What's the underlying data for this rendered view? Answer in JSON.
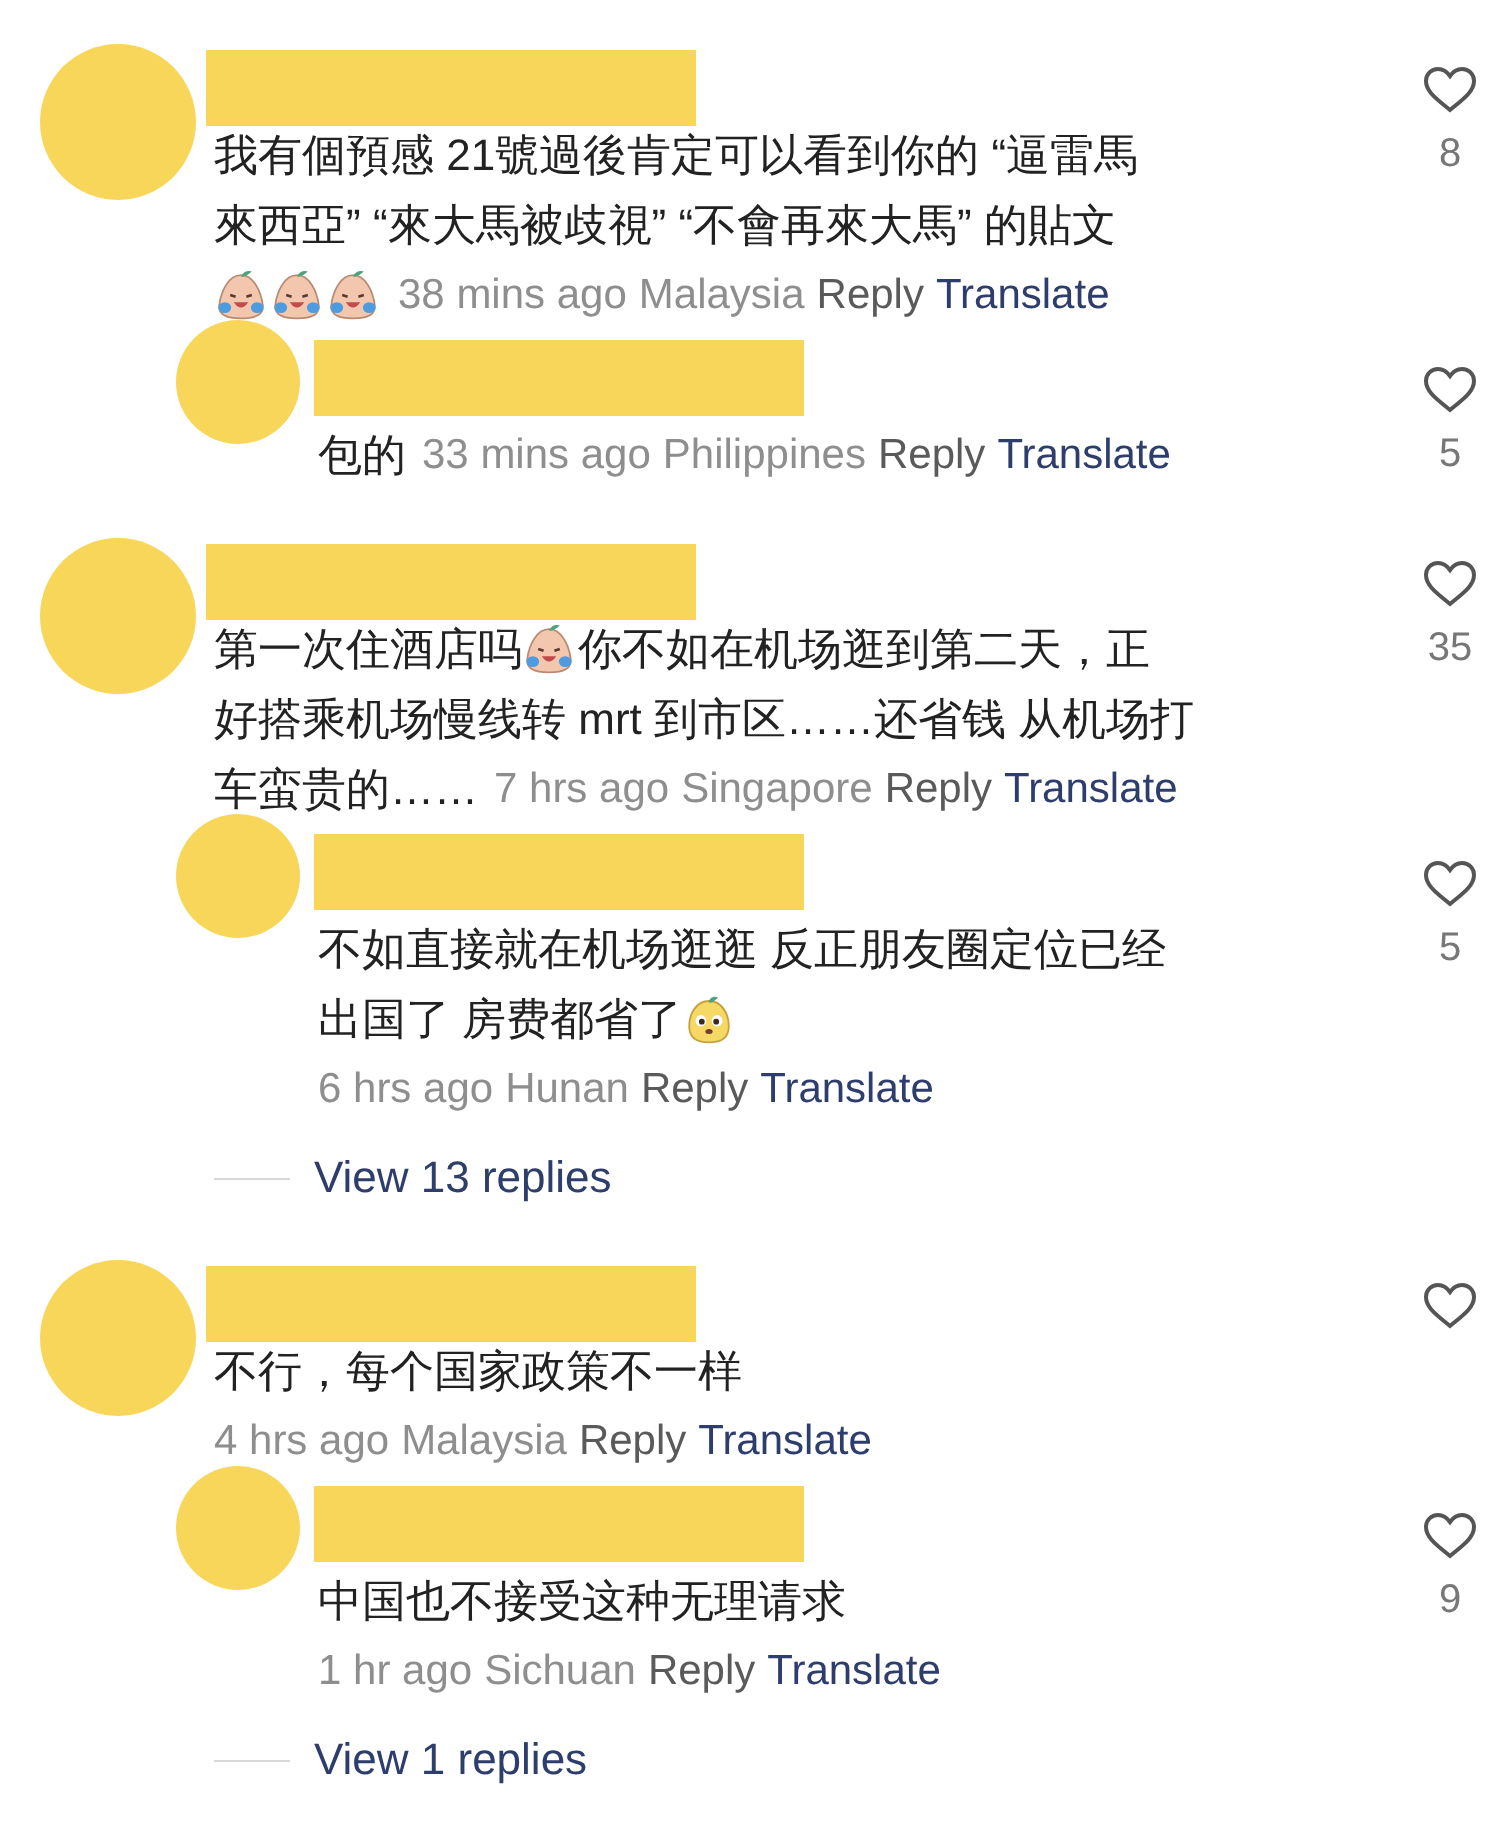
{
  "comments": [
    {
      "lines": [
        [
          {
            "kind": "text",
            "text": "我有個預感 21號過後肯定可以看到你的 “逼雷馬"
          }
        ],
        [
          {
            "kind": "text",
            "text": "來西亞” “來大馬被歧視” “不會再來大馬” 的貼文"
          }
        ],
        [
          {
            "kind": "crying"
          },
          {
            "kind": "crying"
          },
          {
            "kind": "crying"
          },
          {
            "kind": "meta",
            "time": "38 mins ago",
            "location": "Malaysia",
            "reply": "Reply",
            "translate": "Translate"
          }
        ]
      ],
      "likes": "8",
      "replies": [
        {
          "lines": [
            [
              {
                "kind": "text",
                "text": "包的"
              },
              {
                "kind": "meta",
                "time": "33 mins ago",
                "location": "Philippines",
                "reply": "Reply",
                "translate": "Translate"
              }
            ]
          ],
          "likes": "5"
        }
      ]
    },
    {
      "lines": [
        [
          {
            "kind": "text",
            "text": "第一次住酒店吗"
          },
          {
            "kind": "crying"
          },
          {
            "kind": "text",
            "text": "你不如在机场逛到第二天，正"
          }
        ],
        [
          {
            "kind": "text",
            "text": "好搭乘机场慢线转 mrt 到市区……还省钱 从机场打"
          }
        ],
        [
          {
            "kind": "text",
            "text": "车蛮贵的……"
          },
          {
            "kind": "meta",
            "time": "7 hrs ago",
            "location": "Singapore",
            "reply": "Reply",
            "translate": "Translate"
          }
        ]
      ],
      "likes": "35",
      "replies": [
        {
          "lines": [
            [
              {
                "kind": "text",
                "text": "不如直接就在机场逛逛 反正朋友圈定位已经"
              }
            ],
            [
              {
                "kind": "text",
                "text": "出国了 房费都省了"
              },
              {
                "kind": "smile"
              }
            ],
            [
              {
                "kind": "meta",
                "time": "6 hrs ago",
                "location": "Hunan",
                "reply": "Reply",
                "translate": "Translate"
              }
            ]
          ],
          "likes": "5"
        }
      ],
      "view_replies": "View 13 replies"
    },
    {
      "lines": [
        [
          {
            "kind": "text",
            "text": "不行，每个国家政策不一样"
          }
        ],
        [
          {
            "kind": "meta",
            "time": "4 hrs ago",
            "location": "Malaysia",
            "reply": "Reply",
            "translate": "Translate"
          }
        ]
      ],
      "replies": [
        {
          "lines": [
            [
              {
                "kind": "text",
                "text": "中国也不接受这种无理请求"
              }
            ],
            [
              {
                "kind": "meta",
                "time": "1 hr ago",
                "location": "Sichuan",
                "reply": "Reply",
                "translate": "Translate"
              }
            ]
          ],
          "likes": "9"
        }
      ],
      "view_replies": "View 1 replies"
    }
  ]
}
